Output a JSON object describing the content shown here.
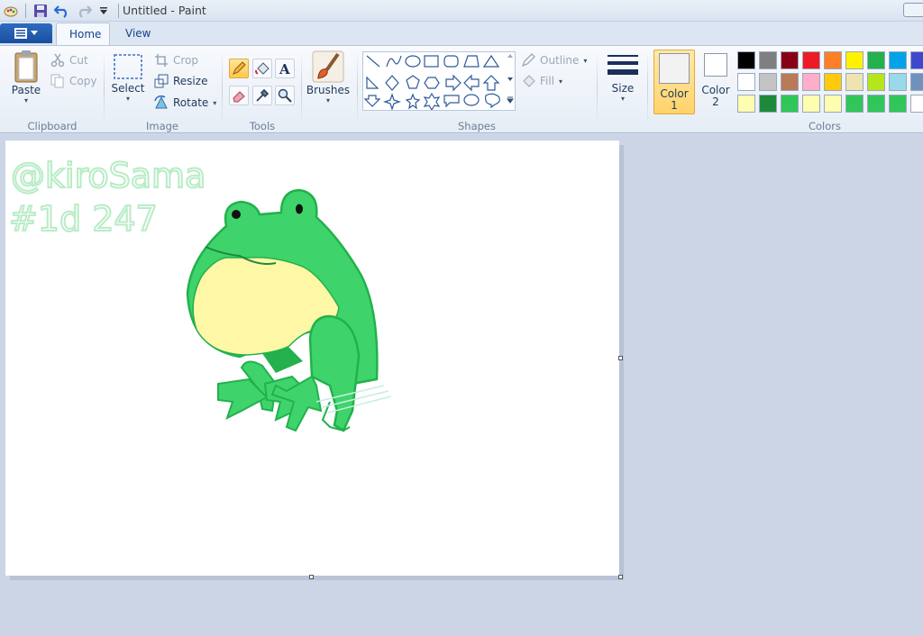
{
  "window": {
    "title": "Untitled - Paint"
  },
  "tabs": [
    {
      "label": "Home"
    },
    {
      "label": "View"
    }
  ],
  "ribbon": {
    "clipboard": {
      "label": "Clipboard",
      "paste": "Paste",
      "cut": "Cut",
      "copy": "Copy"
    },
    "image": {
      "label": "Image",
      "select": "Select",
      "crop": "Crop",
      "resize": "Resize",
      "rotate": "Rotate"
    },
    "tools": {
      "label": "Tools"
    },
    "brushes": {
      "label": "Brushes"
    },
    "shapes": {
      "label": "Shapes",
      "outline": "Outline",
      "fill": "Fill"
    },
    "size": {
      "label": "Size"
    },
    "colors": {
      "label": "Colors",
      "color1": "Color\n1",
      "color1_a": "Color",
      "color1_b": "1",
      "color2_a": "Color",
      "color2_b": "2",
      "palette": [
        [
          "#000000",
          "#7f7f7f",
          "#880015",
          "#ed1c24",
          "#ff7f27",
          "#fff200",
          "#22b14c",
          "#00a2e8",
          "#3f48cc"
        ],
        [
          "#ffffff",
          "#c3c3c3",
          "#b97a57",
          "#ffaec9",
          "#ffc90e",
          "#efe4b0",
          "#b5e61d",
          "#99d9ea",
          "#7092be"
        ],
        [
          "#fffdb0",
          "#1d8a3a",
          "#30c65a",
          "#fffdb0",
          "#fffdb0",
          "#30c65a",
          "#30c65a",
          "#30c65a",
          "#ffffff"
        ]
      ]
    }
  },
  "canvas": {
    "signature_line1": "@kiroSama",
    "signature_line2": "#1d 247",
    "colors": {
      "frog_green": "#3ed46b",
      "frog_outline": "#22b14c",
      "belly": "#fdf7a6",
      "sketch": "#b8ecc6"
    }
  }
}
